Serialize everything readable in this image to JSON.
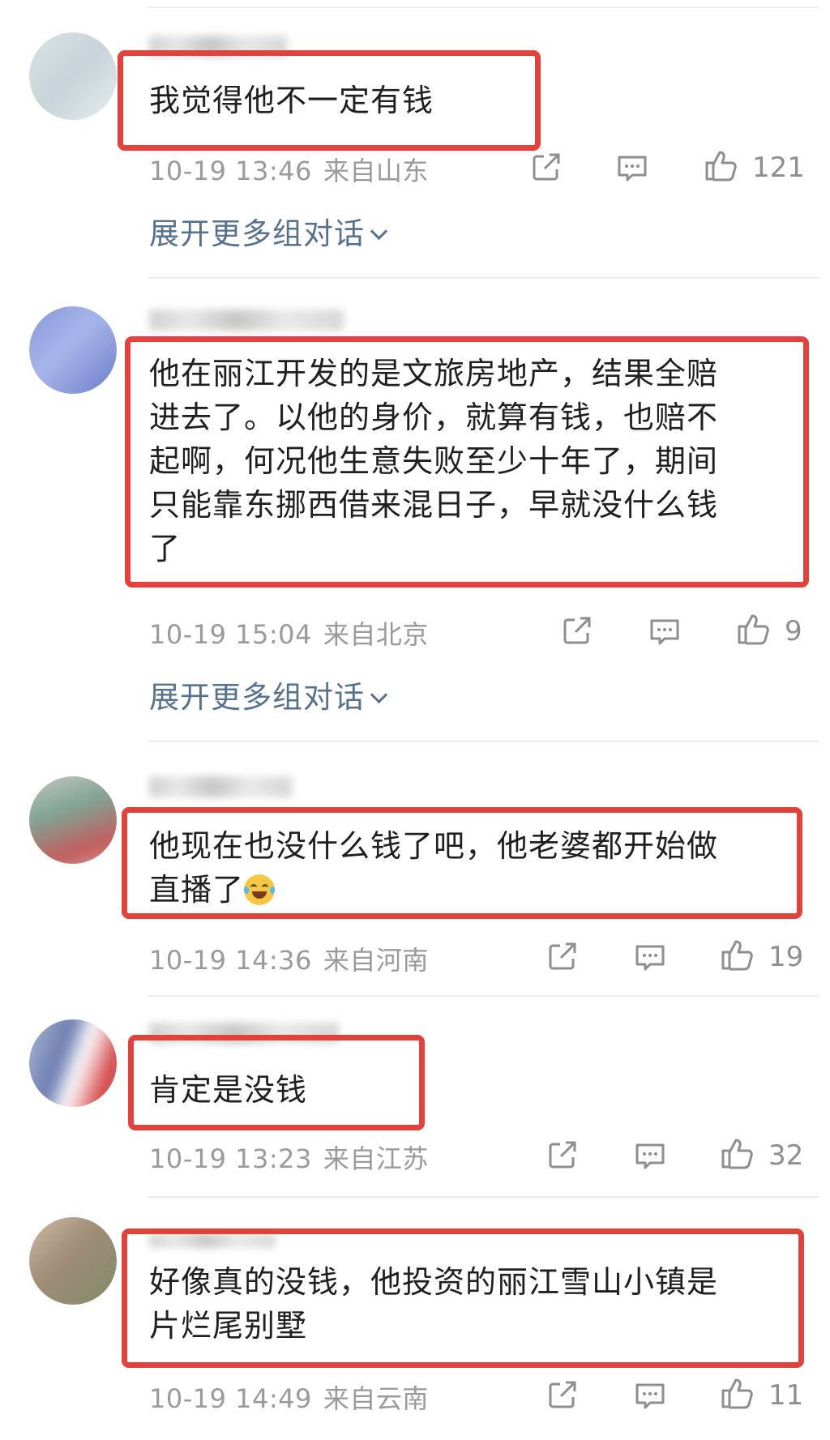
{
  "comments": [
    {
      "text": "我觉得他不一定有钱",
      "date": "10-19 13:46",
      "location": "来自山东",
      "likes": "121",
      "expand": "展开更多组对话",
      "avatar_colors": [
        "#dfe7ea",
        "#c6d3d8",
        "#eef2f3"
      ]
    },
    {
      "text": "他在丽江开发的是文旅房地产，结果全赔\n进去了。以他的身价，就算有钱，也赔不\n起啊，何况他生意失败至少十年了，期间\n只能靠东挪西借来混日子，早就没什么钱\n了",
      "date": "10-19 15:04",
      "location": "来自北京",
      "likes": "9",
      "expand": "展开更多组对话",
      "avatar_colors": [
        "#7d8fd8",
        "#a9b6ea",
        "#5f72c4"
      ]
    },
    {
      "text": "他现在也没什么钱了吧，他老婆都开始做\n直播了",
      "emoji": "laughing-crying",
      "date": "10-19 14:36",
      "location": "来自河南",
      "likes": "19",
      "avatar_colors": [
        "#c65a5a",
        "#7fa596",
        "#d9d0cc"
      ]
    },
    {
      "text": "肯定是没钱",
      "date": "10-19 13:23",
      "location": "来自江苏",
      "likes": "32",
      "avatar_colors": [
        "#6c7bb0",
        "#d23c3c",
        "#bcc6dc"
      ]
    },
    {
      "text": "好像真的没钱，他投资的丽江雪山小镇是\n片烂尾别墅",
      "date": "10-19 14:49",
      "location": "来自云南",
      "likes": "11",
      "avatar_colors": [
        "#a08c76",
        "#d6c7b4",
        "#7a8b69"
      ]
    }
  ],
  "icons": {
    "share": "share-icon",
    "reply": "comment-icon",
    "like": "thumbs-up-icon"
  },
  "colors": {
    "highlight": "#e3413c",
    "link": "#56708e",
    "meta": "#9a9a9a"
  }
}
